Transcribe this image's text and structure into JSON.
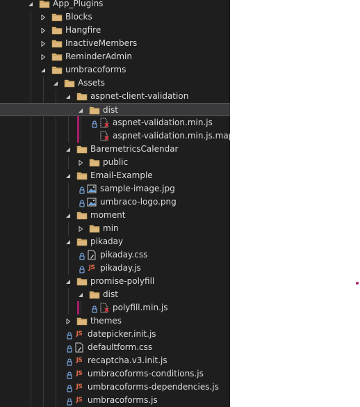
{
  "colors": {
    "pane_background": "#1e1e1e",
    "text": "#dcdcdc",
    "folder": "#dcb67a",
    "lock": "#7aa7e0",
    "js": "#e06c4a",
    "modified_marker": "#a61e6a",
    "arrow": "#c8c8c8"
  },
  "tree": [
    {
      "label": "App_Plugins",
      "type": "folder",
      "expanded": true,
      "depth": 0
    },
    {
      "label": "Blocks",
      "type": "folder",
      "expanded": false,
      "depth": 1
    },
    {
      "label": "Hangfire",
      "type": "folder",
      "expanded": false,
      "depth": 1
    },
    {
      "label": "InactiveMembers",
      "type": "folder",
      "expanded": false,
      "depth": 1
    },
    {
      "label": "ReminderAdmin",
      "type": "folder",
      "expanded": false,
      "depth": 1
    },
    {
      "label": "umbracoforms",
      "type": "folder",
      "expanded": true,
      "depth": 1
    },
    {
      "label": "Assets",
      "type": "folder",
      "expanded": true,
      "depth": 2
    },
    {
      "label": "aspnet-client-validation",
      "type": "folder",
      "expanded": true,
      "depth": 3
    },
    {
      "label": "dist",
      "type": "folder",
      "expanded": true,
      "depth": 4,
      "selected": true
    },
    {
      "label": "aspnet-validation.min.js",
      "type": "file-excluded",
      "depth": 5,
      "locked": true,
      "modified": true
    },
    {
      "label": "aspnet-validation.min.js.map",
      "type": "file-excluded",
      "depth": 5,
      "locked": false,
      "modified": true
    },
    {
      "label": "BaremetricsCalendar",
      "type": "folder",
      "expanded": true,
      "depth": 3
    },
    {
      "label": "public",
      "type": "folder",
      "expanded": false,
      "depth": 4
    },
    {
      "label": "Email-Example",
      "type": "folder",
      "expanded": true,
      "depth": 3
    },
    {
      "label": "sample-image.jpg",
      "type": "image",
      "depth": 4,
      "locked": true
    },
    {
      "label": "umbraco-logo.png",
      "type": "image",
      "depth": 4,
      "locked": true
    },
    {
      "label": "moment",
      "type": "folder",
      "expanded": true,
      "depth": 3
    },
    {
      "label": "min",
      "type": "folder",
      "expanded": false,
      "depth": 4
    },
    {
      "label": "pikaday",
      "type": "folder",
      "expanded": true,
      "depth": 3
    },
    {
      "label": "pikaday.css",
      "type": "css",
      "depth": 4,
      "locked": true
    },
    {
      "label": "pikaday.js",
      "type": "js",
      "depth": 4,
      "locked": true
    },
    {
      "label": "promise-polyfill",
      "type": "folder",
      "expanded": true,
      "depth": 3
    },
    {
      "label": "dist",
      "type": "folder",
      "expanded": true,
      "depth": 4
    },
    {
      "label": "polyfill.min.js",
      "type": "file-excluded",
      "depth": 5,
      "locked": true,
      "modified": true
    },
    {
      "label": "themes",
      "type": "folder",
      "expanded": false,
      "depth": 3
    },
    {
      "label": "datepicker.init.js",
      "type": "js",
      "depth": 3,
      "locked": true
    },
    {
      "label": "defaultform.css",
      "type": "css",
      "depth": 3,
      "locked": true
    },
    {
      "label": "recaptcha.v3.init.js",
      "type": "js",
      "depth": 3,
      "locked": true
    },
    {
      "label": "umbracoforms-conditions.js",
      "type": "js",
      "depth": 3,
      "locked": true
    },
    {
      "label": "umbracoforms-dependencies.js",
      "type": "js",
      "depth": 3,
      "locked": true
    },
    {
      "label": "umbracoforms.js",
      "type": "js",
      "depth": 3,
      "locked": true
    }
  ]
}
